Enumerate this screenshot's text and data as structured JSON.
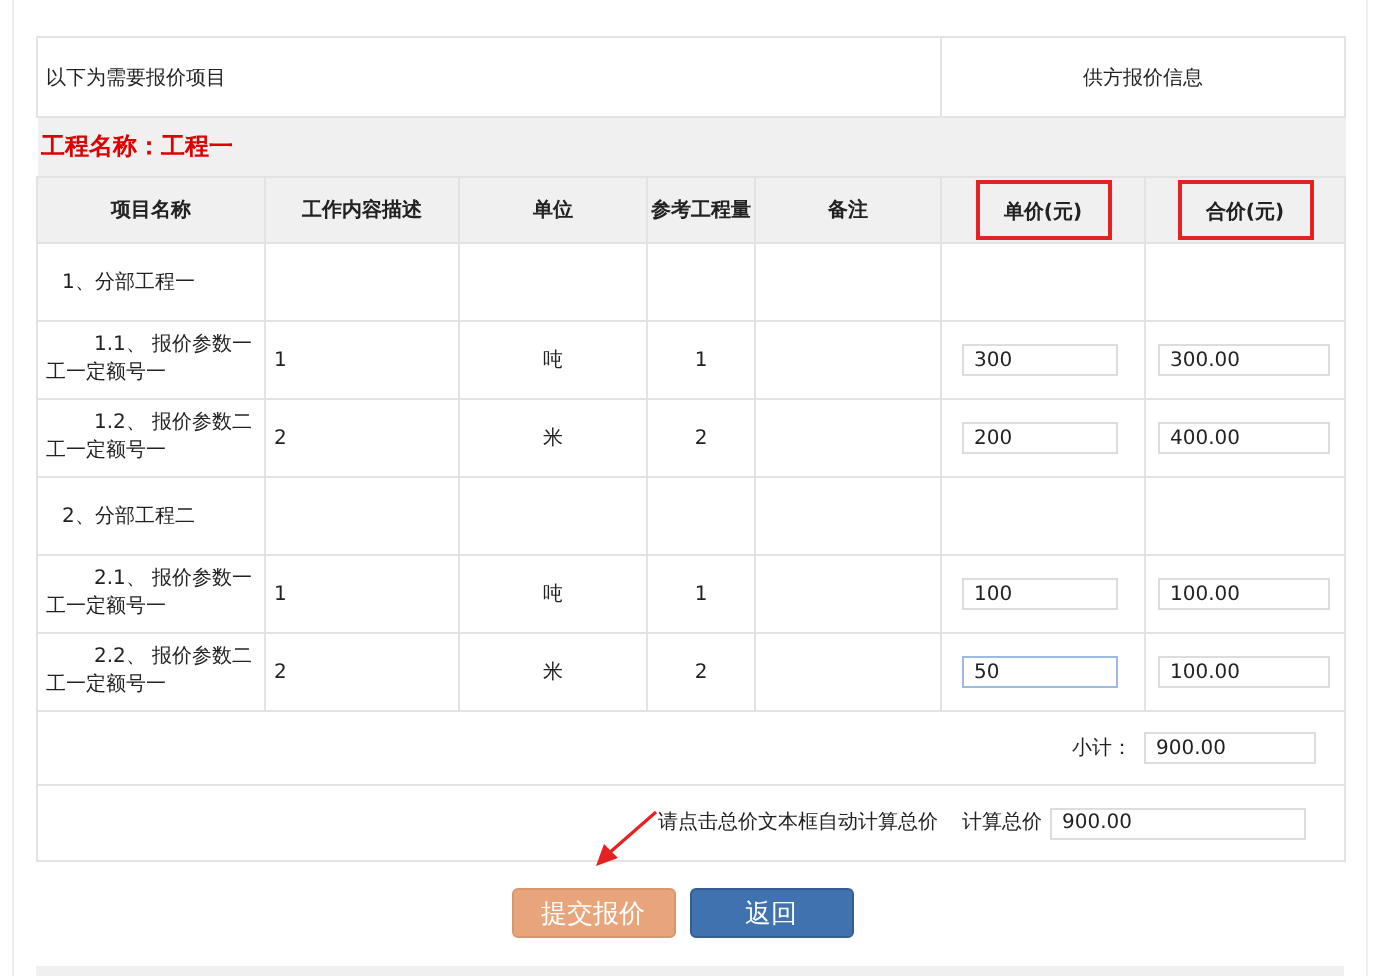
{
  "header": {
    "items_label": "以下为需要报价项目",
    "supplier_label": "供方报价信息"
  },
  "project_name": "工程名称：工程一",
  "columns": [
    {
      "label": "项目名称",
      "highlighted": false
    },
    {
      "label": "工作内容描述",
      "highlighted": false
    },
    {
      "label": "单位",
      "highlighted": false
    },
    {
      "label": "参考工程量",
      "highlighted": false
    },
    {
      "label": "备注",
      "highlighted": false
    },
    {
      "label": "单价(元)",
      "highlighted": true
    },
    {
      "label": "合价(元)",
      "highlighted": true
    }
  ],
  "rows": [
    {
      "kind": "group",
      "name": "1、分部工程一"
    },
    {
      "kind": "item",
      "name": "1.1、 报价参数一工一定额号一",
      "description": "1",
      "unit": "吨",
      "quantity": "1",
      "unit_price": "300",
      "total_price": "300.00",
      "focused": false
    },
    {
      "kind": "item",
      "name": "1.2、 报价参数二工一定额号一",
      "description": "2",
      "unit": "米",
      "quantity": "2",
      "unit_price": "200",
      "total_price": "400.00",
      "focused": false
    },
    {
      "kind": "group",
      "name": "2、分部工程二"
    },
    {
      "kind": "item",
      "name": "2.1、 报价参数一工一定额号一",
      "description": "1",
      "unit": "吨",
      "quantity": "1",
      "unit_price": "100",
      "total_price": "100.00",
      "focused": false
    },
    {
      "kind": "item",
      "name": "2.2、 报价参数二工一定额号一",
      "description": "2",
      "unit": "米",
      "quantity": "2",
      "unit_price": "50",
      "total_price": "100.00",
      "focused": true
    }
  ],
  "subtotal": {
    "label": "小计：",
    "value": "900.00"
  },
  "grand_total": {
    "hint": "请点击总价文本框自动计算总价",
    "label": "计算总价",
    "value": "900.00"
  },
  "buttons": [
    {
      "label": "提交报价",
      "kind": "primary"
    },
    {
      "label": "返回",
      "kind": "secondary"
    }
  ]
}
